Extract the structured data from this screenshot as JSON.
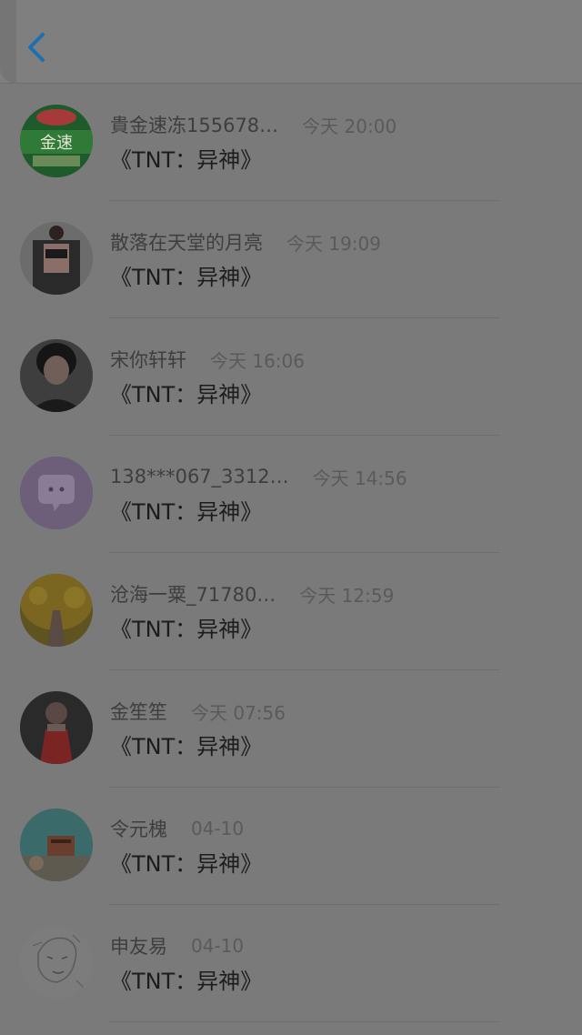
{
  "header": {
    "back_icon": "chevron-left-icon",
    "accent_color": "#1e6fb0"
  },
  "list": [
    {
      "avatar": "food-store-logo-avatar",
      "name": "貴金速冻155678…",
      "time": "今天 20:00",
      "message": "《TNT：异神》"
    },
    {
      "avatar": "person-dark-jacket-avatar",
      "name": "散落在天堂的月亮",
      "time": "今天 19:09",
      "message": "《TNT：异神》"
    },
    {
      "avatar": "young-man-avatar",
      "name": "宋你轩轩",
      "time": "今天 16:06",
      "message": "《TNT：异神》"
    },
    {
      "avatar": "purple-chat-avatar",
      "name": "138***067_3312…",
      "time": "今天 14:56",
      "message": "《TNT：异神》"
    },
    {
      "avatar": "autumn-tree-avatar",
      "name": "沧海一粟_71780…",
      "time": "今天 12:59",
      "message": "《TNT：异神》"
    },
    {
      "avatar": "girl-red-dress-avatar",
      "name": "金笙笙",
      "time": "今天 07:56",
      "message": "《TNT：异神》"
    },
    {
      "avatar": "anime-scene-avatar",
      "name": "令元槐",
      "time": "04-10",
      "message": "《TNT：异神》"
    },
    {
      "avatar": "sketch-drawing-avatar",
      "name": "申友易",
      "time": "04-10",
      "message": "《TNT：异神》"
    }
  ]
}
